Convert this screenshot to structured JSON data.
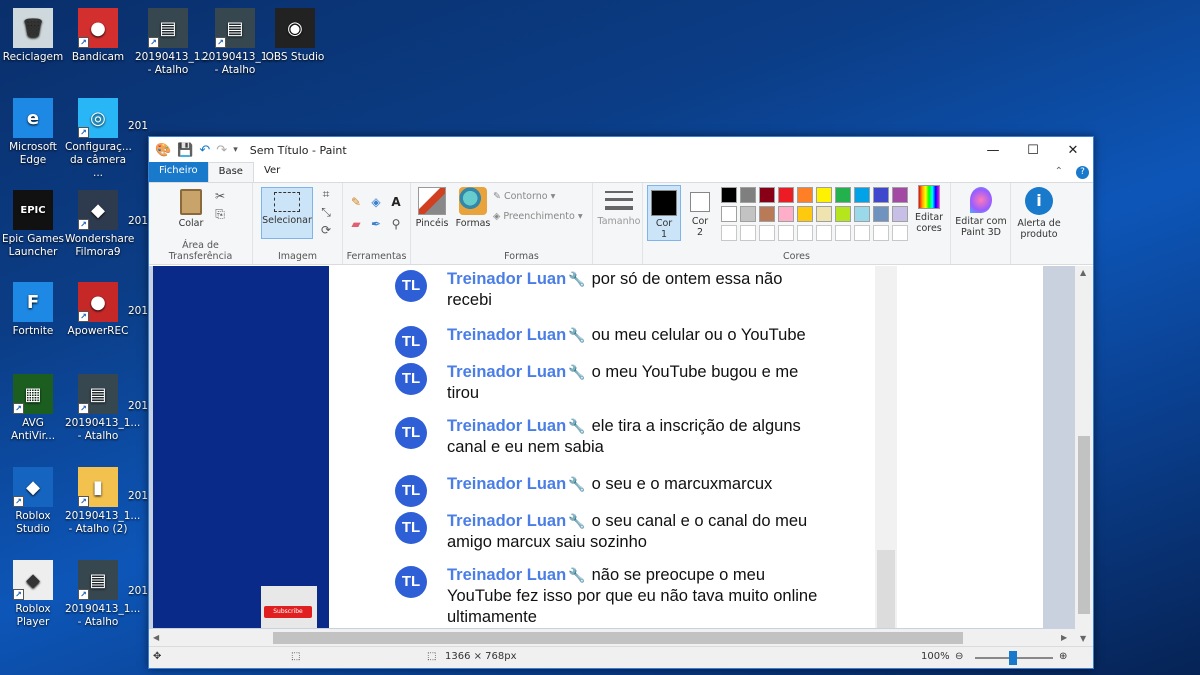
{
  "desktop": {
    "icons": [
      {
        "label": "Reciclagem",
        "icon": "recycle-bin-icon"
      },
      {
        "label": "Bandicam",
        "icon": "bandicam-icon"
      },
      {
        "label": "20190413_1...\n- Atalho",
        "icon": "video-shortcut-icon"
      },
      {
        "label": "20190413_1...\n- Atalho",
        "icon": "video-shortcut-icon"
      },
      {
        "label": "OBS Studio",
        "icon": "obs-icon"
      },
      {
        "label": "Microsoft\nEdge",
        "icon": "edge-icon"
      },
      {
        "label": "Configuraç...\nda câmera ...",
        "icon": "camera-settings-icon"
      },
      {
        "label": "Epic Games\nLauncher",
        "icon": "epic-games-icon"
      },
      {
        "label": "Wondershare\nFilmora9",
        "icon": "filmora-icon"
      },
      {
        "label": "Fortnite",
        "icon": "fortnite-icon"
      },
      {
        "label": "ApowerREC",
        "icon": "apowerrec-icon"
      },
      {
        "label": "AVG\nAntiVir...",
        "icon": "avg-icon"
      },
      {
        "label": "20190413_1...\n- Atalho",
        "icon": "video-shortcut-icon"
      },
      {
        "label": "Roblox\nStudio",
        "icon": "roblox-studio-icon"
      },
      {
        "label": "20190413_1...\n- Atalho (2)",
        "icon": "zip-folder-icon"
      },
      {
        "label": "Roblox Player",
        "icon": "roblox-player-icon"
      },
      {
        "label": "20190413_1...\n- Atalho",
        "icon": "video-shortcut-icon"
      }
    ],
    "partial_label": "201"
  },
  "window": {
    "title": "Sem Título - Paint",
    "tabs": {
      "file": "Ficheiro",
      "home": "Base",
      "view": "Ver"
    }
  },
  "ribbon": {
    "clipboard": {
      "paste": "Colar",
      "group": "Área de Transferência"
    },
    "image": {
      "select": "Selecionar",
      "group": "Imagem"
    },
    "tools": {
      "group": "Ferramentas"
    },
    "brushes": {
      "label": "Pincéis"
    },
    "shapes": {
      "label": "Formas",
      "outline": "Contorno",
      "fill": "Preenchimento",
      "group": "Formas"
    },
    "size": {
      "label": "Tamanho"
    },
    "colors": {
      "color1": "Cor\n1",
      "color2": "Cor\n2",
      "edit": "Editar\ncores",
      "group": "Cores",
      "color1_value": "#000000",
      "color2_value": "#ffffff",
      "palette_row1": [
        "#000000",
        "#7f7f7f",
        "#880015",
        "#ed1c24",
        "#ff7f27",
        "#fff200",
        "#22b14c",
        "#00a2e8",
        "#3f48cc",
        "#a349a4"
      ],
      "palette_row2": [
        "#ffffff",
        "#c3c3c3",
        "#b97a57",
        "#ffaec9",
        "#ffc90e",
        "#efe4b0",
        "#b5e61d",
        "#99d9ea",
        "#7092be",
        "#c8bfe7"
      ]
    },
    "paint3d": "Editar com\nPaint 3D",
    "product_alert": "Alerta de\nproduto"
  },
  "chat": {
    "author": "Treinador Luan",
    "avatar_text": "TL",
    "messages": [
      {
        "line1": "por só de ontem essa não",
        "line2": "recebi"
      },
      {
        "line1": "ou meu celular ou o YouTube",
        "line2": ""
      },
      {
        "line1": "o meu YouTube bugou e me",
        "line2": "tirou"
      },
      {
        "line1": "ele tira a inscrição de alguns",
        "line2": "canal e eu nem sabia"
      },
      {
        "line1": "o seu e o marcuxmarcux",
        "line2": ""
      },
      {
        "line1": "o seu canal e o canal do meu",
        "line2": "amigo marcux saiu sozinho"
      },
      {
        "line1": "não se preocupe o meu",
        "line2": "YouTube fez isso por que eu não tava muito online",
        "line3": "ultimamente"
      }
    ],
    "subscribe": "Subscribe"
  },
  "statusbar": {
    "dimensions": "1366 × 768px",
    "zoom": "100%"
  }
}
